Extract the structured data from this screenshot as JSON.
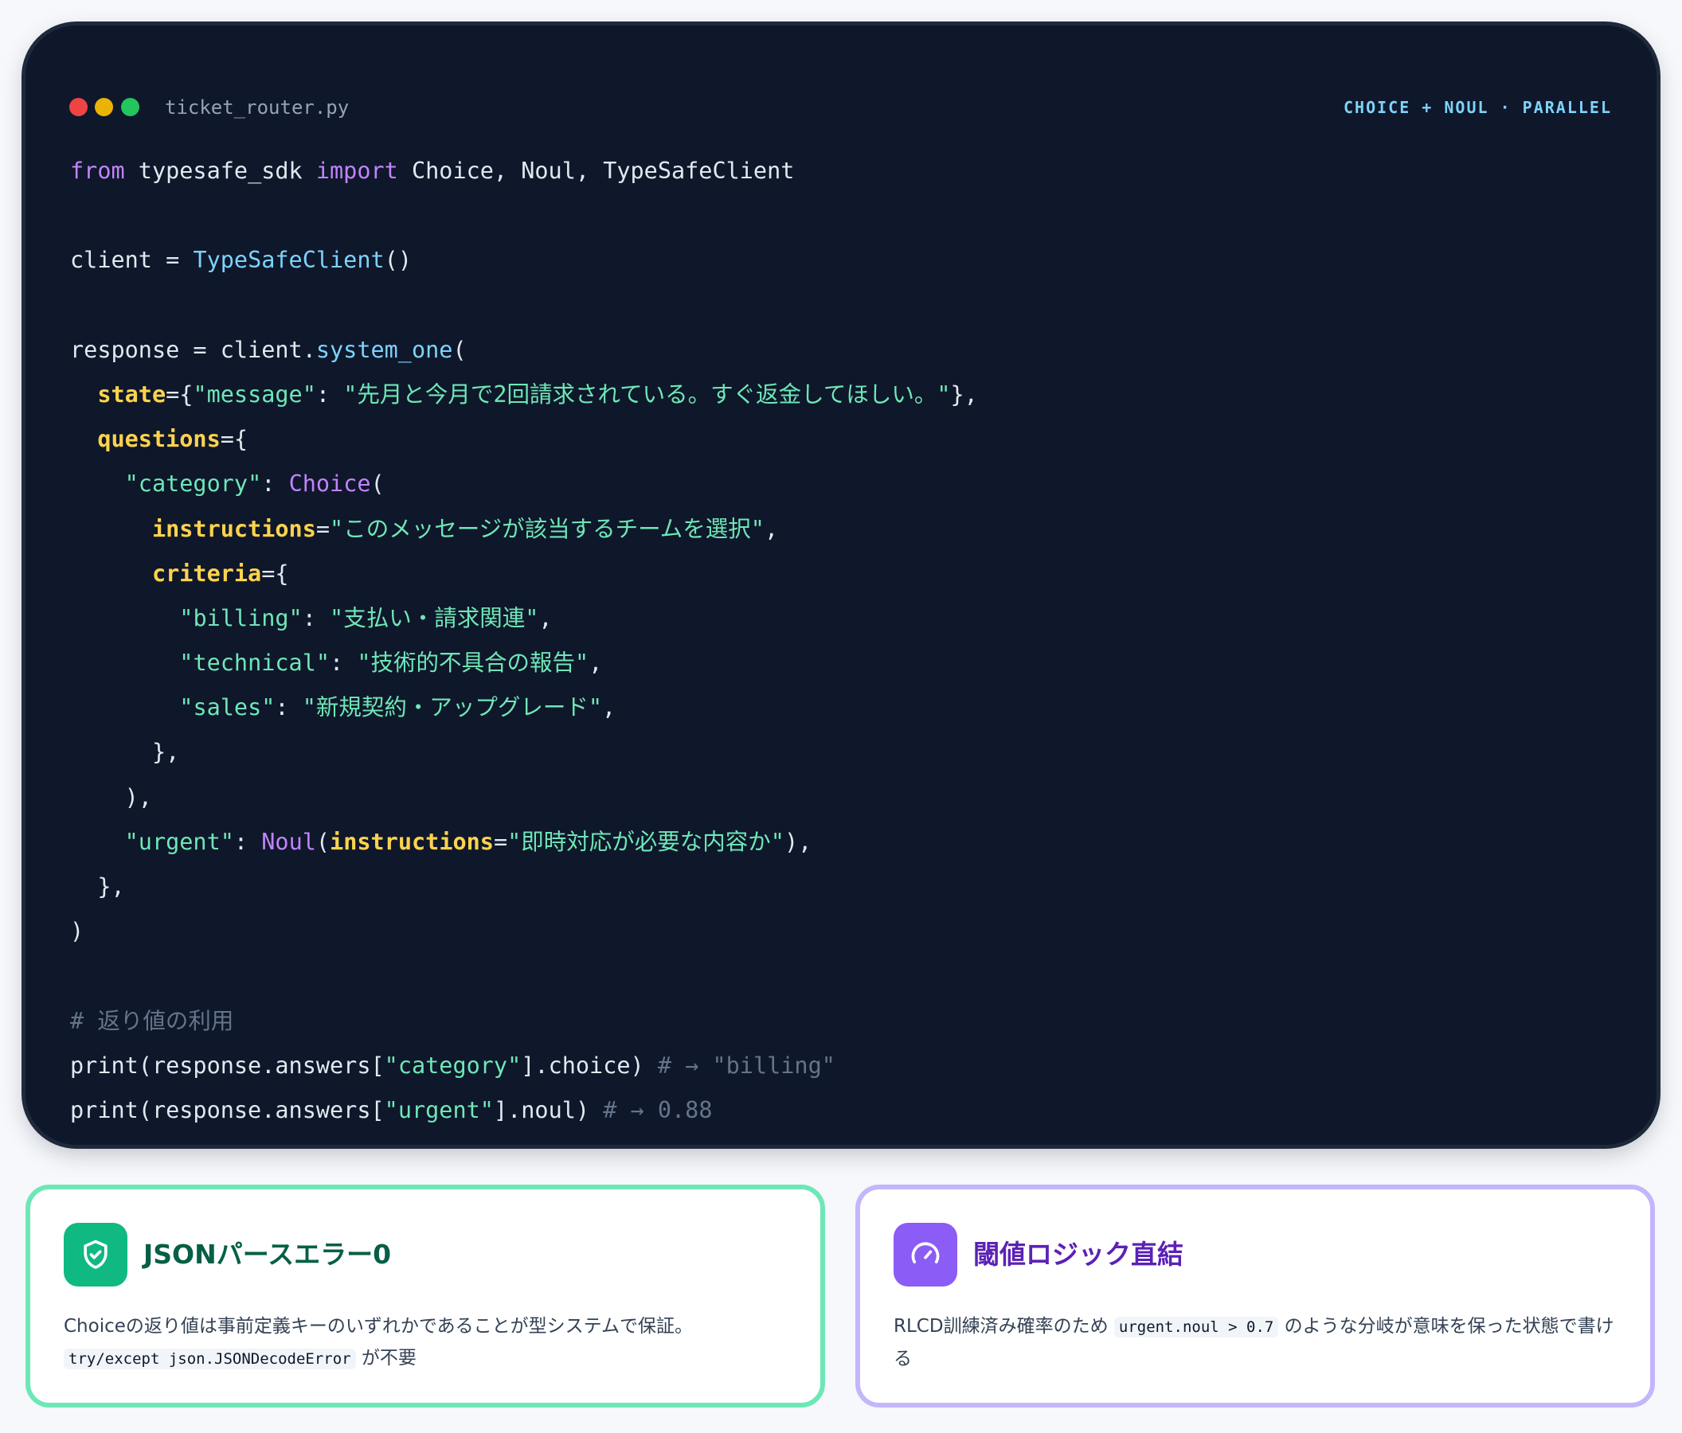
{
  "window": {
    "filename": "ticket_router.py",
    "badge": "CHOICE + NOUL · PARALLEL",
    "traffic_lights": {
      "close": "#ef4444",
      "minimize": "#eab308",
      "zoom": "#22c55e"
    }
  },
  "code": {
    "lines": [
      [
        {
          "t": "from",
          "k": "kw"
        },
        {
          "t": " typesafe_sdk "
        },
        {
          "t": "import",
          "k": "kw"
        },
        {
          "t": " Choice, Noul, TypeSafeClient"
        }
      ],
      [],
      [
        {
          "t": "client = "
        },
        {
          "t": "TypeSafeClient",
          "k": "fn"
        },
        {
          "t": "()"
        }
      ],
      [],
      [
        {
          "t": "response = client."
        },
        {
          "t": "system_one",
          "k": "fn"
        },
        {
          "t": "("
        }
      ],
      [
        {
          "t": "  "
        },
        {
          "t": "state",
          "k": "param"
        },
        {
          "t": "={"
        },
        {
          "t": "\"message\"",
          "k": "str"
        },
        {
          "t": ": "
        },
        {
          "t": "\"先月と今月で2回請求されている。すぐ返金してほしい。\"",
          "k": "str"
        },
        {
          "t": "},"
        }
      ],
      [
        {
          "t": "  "
        },
        {
          "t": "questions",
          "k": "param"
        },
        {
          "t": "={"
        }
      ],
      [
        {
          "t": "    "
        },
        {
          "t": "\"category\"",
          "k": "str"
        },
        {
          "t": ": "
        },
        {
          "t": "Choice",
          "k": "cls"
        },
        {
          "t": "("
        }
      ],
      [
        {
          "t": "      "
        },
        {
          "t": "instructions",
          "k": "param"
        },
        {
          "t": "="
        },
        {
          "t": "\"このメッセージが該当するチームを選択\"",
          "k": "str"
        },
        {
          "t": ","
        }
      ],
      [
        {
          "t": "      "
        },
        {
          "t": "criteria",
          "k": "param"
        },
        {
          "t": "={"
        }
      ],
      [
        {
          "t": "        "
        },
        {
          "t": "\"billing\"",
          "k": "str"
        },
        {
          "t": ": "
        },
        {
          "t": "\"支払い・請求関連\"",
          "k": "str"
        },
        {
          "t": ","
        }
      ],
      [
        {
          "t": "        "
        },
        {
          "t": "\"technical\"",
          "k": "str"
        },
        {
          "t": ": "
        },
        {
          "t": "\"技術的不具合の報告\"",
          "k": "str"
        },
        {
          "t": ","
        }
      ],
      [
        {
          "t": "        "
        },
        {
          "t": "\"sales\"",
          "k": "str"
        },
        {
          "t": ": "
        },
        {
          "t": "\"新規契約・アップグレード\"",
          "k": "str"
        },
        {
          "t": ","
        }
      ],
      [
        {
          "t": "      },"
        }
      ],
      [
        {
          "t": "    ),"
        }
      ],
      [
        {
          "t": "    "
        },
        {
          "t": "\"urgent\"",
          "k": "str"
        },
        {
          "t": ": "
        },
        {
          "t": "Noul",
          "k": "cls"
        },
        {
          "t": "("
        },
        {
          "t": "instructions",
          "k": "param"
        },
        {
          "t": "="
        },
        {
          "t": "\"即時対応が必要な内容か\"",
          "k": "str"
        },
        {
          "t": "),"
        }
      ],
      [
        {
          "t": "  },"
        }
      ],
      [
        {
          "t": ")"
        }
      ],
      [],
      [
        {
          "t": "# 返り値の利用",
          "k": "cm"
        }
      ],
      [
        {
          "t": "print(response.answers["
        },
        {
          "t": "\"category\"",
          "k": "str"
        },
        {
          "t": "].choice) "
        },
        {
          "t": "# → \"billing\"",
          "k": "cm"
        }
      ],
      [
        {
          "t": "print(response.answers["
        },
        {
          "t": "\"urgent\"",
          "k": "str"
        },
        {
          "t": "].noul) "
        },
        {
          "t": "# → 0.88",
          "k": "cm"
        }
      ]
    ]
  },
  "cards": [
    {
      "icon": "shield-check-icon",
      "title": "JSONパースエラー0",
      "desc_before": "Choiceの返り値は事前定義キーのいずれかであることが型システムで保証。",
      "code": "try/except json.JSONDecodeError",
      "desc_after": " が不要"
    },
    {
      "icon": "gauge-icon",
      "title": "閾値ロジック直結",
      "desc_before": "RLCD訓練済み確率のため ",
      "code": "urgent.noul > 0.7",
      "desc_after": " のような分岐が意味を保った状態で書ける"
    }
  ]
}
